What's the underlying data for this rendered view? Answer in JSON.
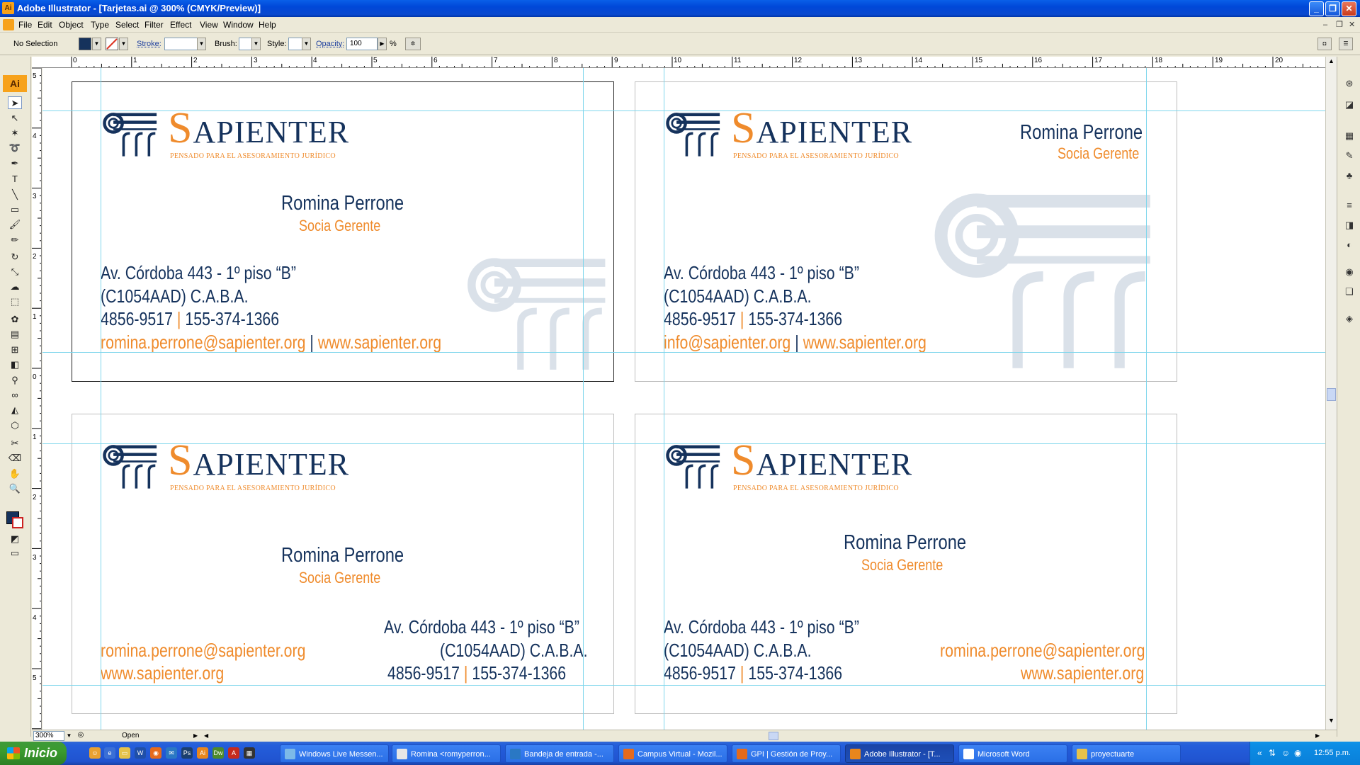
{
  "window": {
    "title": "Adobe Illustrator - [Tarjetas.ai @ 300% (CMYK/Preview)]"
  },
  "menu": [
    "File",
    "Edit",
    "Object",
    "Type",
    "Select",
    "Filter",
    "Effect",
    "View",
    "Window",
    "Help"
  ],
  "control": {
    "selection": "No Selection",
    "stroke_label": "Stroke:",
    "brush_label": "Brush:",
    "style_label": "Style:",
    "opacity_label": "Opacity:",
    "opacity_value": "100",
    "percent": "%"
  },
  "toolbox": {
    "logo": "Ai"
  },
  "ruler_h": [
    "0",
    "1",
    "2",
    "3",
    "4",
    "5",
    "6",
    "7",
    "8",
    "9",
    "10",
    "11",
    "12",
    "13",
    "14",
    "15",
    "16",
    "17",
    "18",
    "19",
    "20"
  ],
  "ruler_v": [
    "5",
    "4",
    "3",
    "2",
    "1",
    "0",
    "1",
    "2",
    "3",
    "4",
    "5"
  ],
  "brand": {
    "s": "S",
    "rest": "APIENTER",
    "tagline": "PENSADO PARA EL ASESORAMIENTO JURÍDICO"
  },
  "cards": [
    {
      "name": "Romina Perrone",
      "role": "Socia Gerente",
      "address1": "Av. Córdoba 443 - 1º piso “B”",
      "address2": "(C1054AAD) C.A.B.A.",
      "phone1": "4856-9517",
      "phone2": "155-374-1366",
      "email": "romina.perrone@sapienter.org",
      "web": "www.sapienter.org"
    },
    {
      "name": "Romina Perrone",
      "role": "Socia Gerente",
      "address1": "Av. Córdoba 443 - 1º piso “B”",
      "address2": "(C1054AAD) C.A.B.A.",
      "phone1": "4856-9517",
      "phone2": "155-374-1366",
      "email": "info@sapienter.org",
      "web": "www.sapienter.org"
    },
    {
      "name": "Romina Perrone",
      "role": "Socia Gerente",
      "address1": "Av. Córdoba 443 - 1º piso “B”",
      "address2": "(C1054AAD) C.A.B.A.",
      "phone1": "4856-9517",
      "phone2": "155-374-1366",
      "email": "romina.perrone@sapienter.org",
      "web": "www.sapienter.org"
    },
    {
      "name": "Romina Perrone",
      "role": "Socia Gerente",
      "address1": "Av. Córdoba 443 - 1º piso “B”",
      "address2": "(C1054AAD) C.A.B.A.",
      "phone1": "4856-9517",
      "phone2": "155-374-1366",
      "email": "romina.perrone@sapienter.org",
      "web": "www.sapienter.org"
    }
  ],
  "separator": "|",
  "statusbar": {
    "zoom": "300%",
    "status": "Open"
  },
  "taskbar": {
    "start": "Inicio",
    "tasks": [
      "Windows Live Messen...",
      "Romina <romyperron...",
      "Bandeja de entrada -...",
      "Campus Virtual - Mozil...",
      "GPI | Gestión de Proy...",
      "Adobe Illustrator - [T...",
      "Microsoft Word",
      "proyectuarte"
    ],
    "clock": "12:55 p.m."
  },
  "colors": {
    "navy": "#15325c",
    "orange": "#ef8b2c",
    "guide": "#7fd6ec"
  }
}
